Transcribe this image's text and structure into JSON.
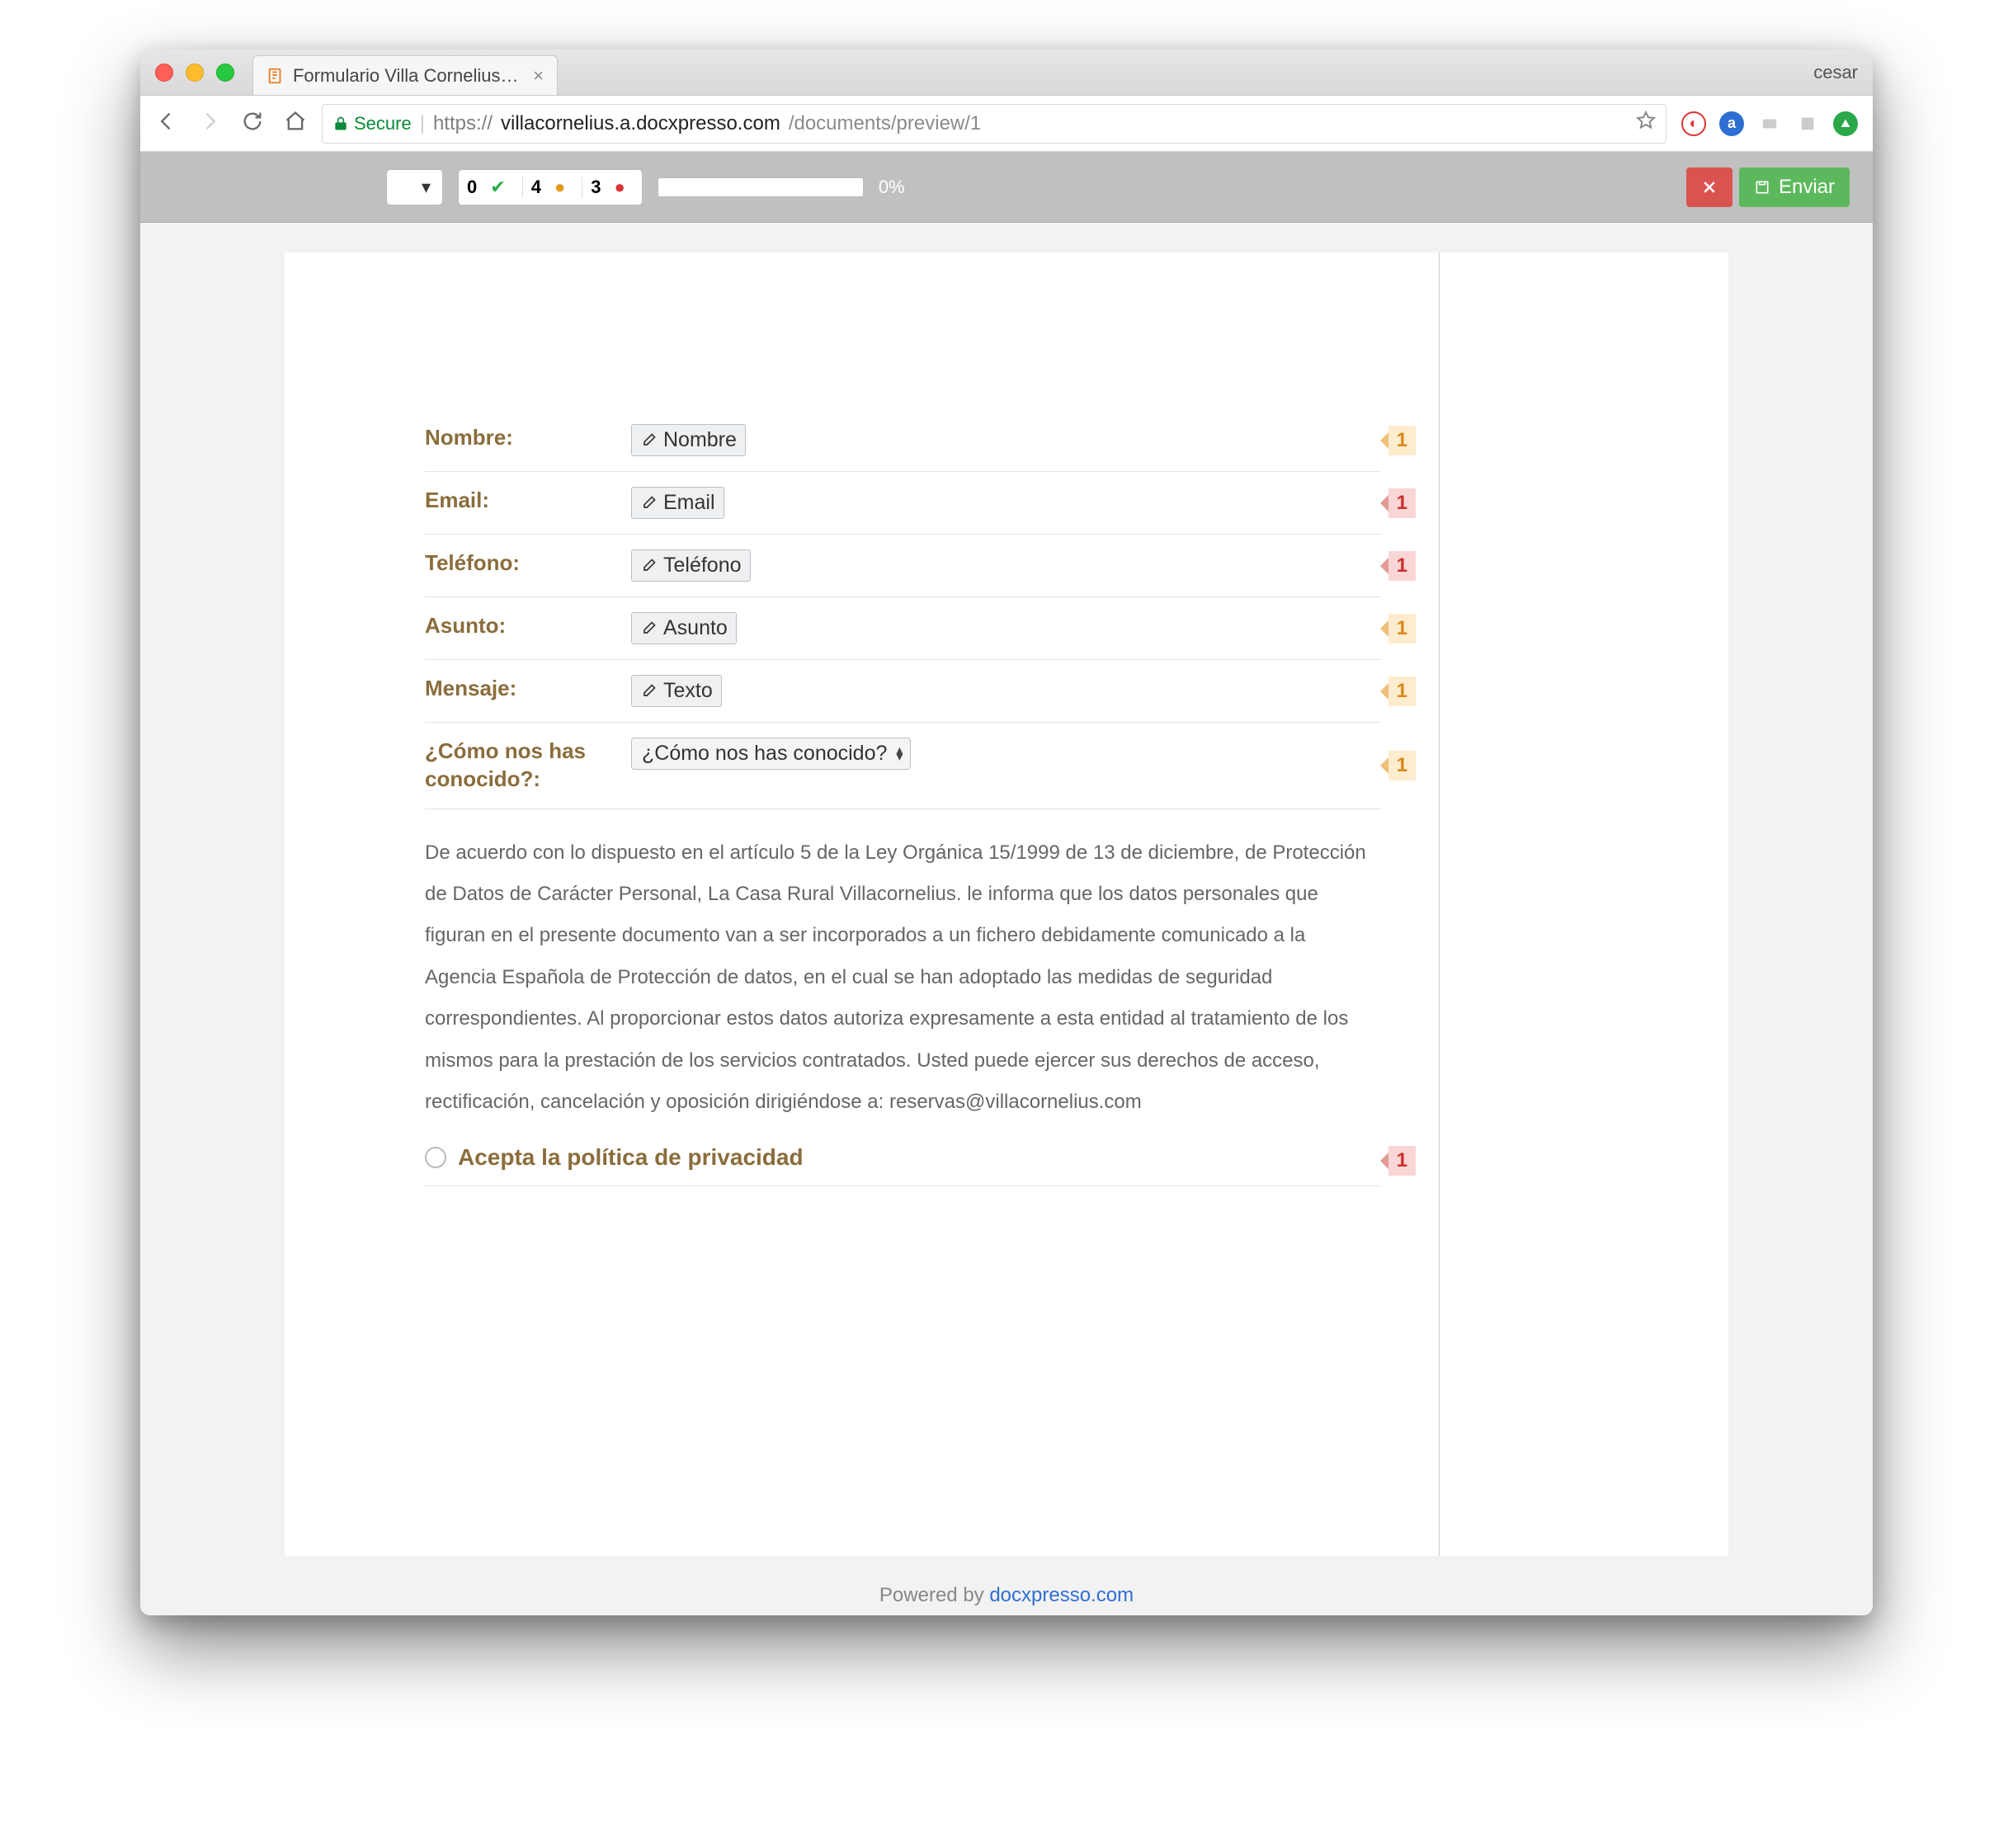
{
  "browser": {
    "tab_title": "Formulario Villa Cornelius - Ge",
    "user": "cesar",
    "secure_label": "Secure",
    "url_scheme": "https://",
    "url_domain": "villacornelius.a.docxpresso.com",
    "url_path": "/documents/preview/1"
  },
  "appbar": {
    "stat_ok": "0",
    "stat_warn": "4",
    "stat_err": "3",
    "progress_pct": "0%",
    "send_label": "Enviar"
  },
  "form": {
    "fields": [
      {
        "label": "Nombre:",
        "placeholder": "Nombre",
        "marker": {
          "color": "orange",
          "count": "1"
        }
      },
      {
        "label": "Email:",
        "placeholder": "Email",
        "marker": {
          "color": "red",
          "count": "1"
        }
      },
      {
        "label": "Teléfono:",
        "placeholder": "Teléfono",
        "marker": {
          "color": "red",
          "count": "1"
        }
      },
      {
        "label": "Asunto:",
        "placeholder": "Asunto",
        "marker": {
          "color": "orange",
          "count": "1"
        }
      },
      {
        "label": "Mensaje:",
        "placeholder": "Texto",
        "marker": {
          "color": "orange",
          "count": "1"
        }
      }
    ],
    "select": {
      "label": "¿Cómo nos has conocido?:",
      "selected": "¿Cómo nos has conocido?",
      "marker": {
        "color": "orange",
        "count": "1"
      }
    },
    "legal": "De acuerdo con lo dispuesto en el artículo 5 de la Ley Orgánica 15/1999 de 13 de diciembre, de Protección de Datos de Carácter Personal, La Casa Rural Villacornelius. le informa que los datos personales que figuran en el presente documento van a ser incorporados a un fichero debidamente comunicado a la Agencia Española de Protección de datos, en el cual se han adoptado las medidas de seguridad correspondientes. Al proporcionar estos datos autoriza expresamente a esta entidad al tratamiento de los mismos para la prestación de los servicios contratados. Usted puede ejercer sus derechos de acceso, rectificación, cancelación y oposición dirigiéndose a: reservas@villacornelius.com",
    "accept_label": "Acepta la política de privacidad",
    "accept_marker": {
      "color": "red",
      "count": "1"
    }
  },
  "footer": {
    "prefix": "Powered by ",
    "link": "docxpresso.com"
  }
}
